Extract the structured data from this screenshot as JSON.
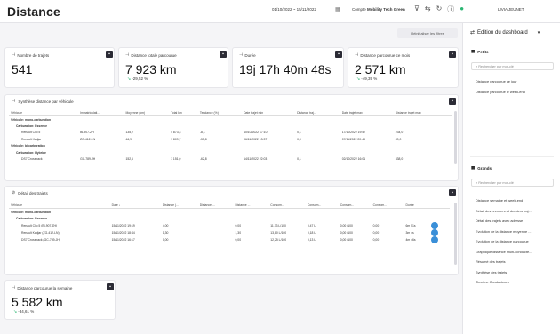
{
  "header": {
    "title": "Distance",
    "date_range": "01/10/2022 ~ 15/11/2022",
    "account_prefix": "Compte",
    "account_name": "Mobility Tech Green",
    "user": "LIVIA JEUNET",
    "icons": [
      "calendar-icon",
      "filter-icon",
      "reset-filter-icon",
      "refresh-icon",
      "help-icon",
      "user-icon"
    ]
  },
  "toolbar": {
    "reset_label": "Réinitialiser les filtres"
  },
  "kpis": [
    {
      "label": "Nombre de trajets",
      "value": "541",
      "delta": ""
    },
    {
      "label": "Distance totale parcourue",
      "value": "7 923 km",
      "delta": "-29,52 %"
    },
    {
      "label": "Durée",
      "value": "19j 17h 40m 48s",
      "delta": ""
    },
    {
      "label": "Distance parcourue ce mois",
      "value": "2 571 km",
      "delta": "-49,39 %"
    }
  ],
  "synthese": {
    "title": "Synthèse distance par véhicule",
    "columns": [
      "Véhicule",
      "Immatriculati...",
      "Moyenne (km)",
      "Total km",
      "Tendance (%)",
      "Date trajet min",
      "Distance traj...",
      "Date trajet max",
      "Distance trajet max"
    ],
    "rows": [
      {
        "type": "g1",
        "cells": [
          "Véhicule: mono-carburation",
          "",
          "",
          "",
          "",
          "",
          "",
          "",
          ""
        ]
      },
      {
        "type": "g2",
        "cells": [
          "Carburation: Essence",
          "",
          "",
          "",
          "",
          "",
          "",
          "",
          ""
        ]
      },
      {
        "type": "r",
        "cells": [
          "Renault Clio 5",
          "BI-907-ZH",
          "135,2",
          "4 873,3",
          "-8,1",
          "10/10/2022 17:10",
          "0,1",
          "17/10/2022 19:57",
          "234,0"
        ]
      },
      {
        "type": "r",
        "cells": [
          "Renault Kadjar",
          "ZG-412-LN",
          "46,9",
          "1 809,7",
          "-55,8",
          "06/11/2022 13:37",
          "0,0",
          "07/11/2022 20:48",
          "89,0"
        ]
      },
      {
        "type": "g1",
        "cells": [
          "Véhicule: bi-carburation",
          "",
          "",
          "",
          "",
          "",
          "",
          "",
          ""
        ]
      },
      {
        "type": "g2",
        "cells": [
          "Carburation: Hybride",
          "",
          "",
          "",
          "",
          "",
          "",
          "",
          ""
        ]
      },
      {
        "type": "r",
        "cells": [
          "DS7 Crossback",
          "GC-789-JH",
          "152,6",
          "1 151,0",
          "-62,8",
          "14/11/2022 22:03",
          "0,1",
          "02/10/2022 16:01",
          "338,0"
        ]
      }
    ]
  },
  "detail": {
    "title": "Détail des trajets",
    "columns": [
      "Véhicule",
      "Date ↓",
      "Distance (...",
      "Distance ...",
      "Distance ...",
      "Consom...",
      "Consom...",
      "Consom...",
      "Consom...",
      "Durée",
      ""
    ],
    "rows": [
      {
        "type": "g1",
        "cells": [
          "Véhicule: mono-carburation",
          "",
          "",
          "",
          "",
          "",
          "",
          "",
          "",
          "",
          ""
        ]
      },
      {
        "type": "g2",
        "cells": [
          "Carburation: Essence",
          "",
          "",
          "",
          "",
          "",
          "",
          "",
          "",
          "",
          ""
        ]
      },
      {
        "type": "r",
        "cells": [
          "Renault Clio 5 (BI-907-ZH)",
          "15/11/2022 19:19",
          "4,00",
          "",
          "0,00",
          "11,73 L/100",
          "0,47 L",
          "0,00 /100",
          "0,00",
          "6m 51s",
          ""
        ]
      },
      {
        "type": "r",
        "cells": [
          "Renault Kadjar (ZG-412-LN)",
          "15/11/2022 18:44",
          "1,30",
          "",
          "1,30",
          "13,80 L/100",
          "0,18 L",
          "0,00 /100",
          "0,00",
          "3m 4s",
          ""
        ]
      },
      {
        "type": "r",
        "cells": [
          "DS7 Crossback (GC-789-JH)",
          "15/11/2022 16:17",
          "0,00",
          "",
          "0,00",
          "12,25 L/100",
          "0,13 L",
          "0,00 /100",
          "0,00",
          "4m 46s",
          ""
        ]
      }
    ]
  },
  "weekly": {
    "label": "Distance parcourue la semaine",
    "value": "5 582 km",
    "delta": "-34,61 %"
  },
  "sidebar": {
    "title": "Edition du dashboard",
    "petits_title": "Petits",
    "search_placeholder": "Rechercher par mot-clé",
    "petits": [
      "Distance parcourue ce jour",
      "Distance parcourue le week-end"
    ],
    "grands_title": "Grands",
    "grands": [
      "Distance semaine et week-end",
      "Détail des premiers et derniers traj...",
      "Détail des trajets avec adresse",
      "Evolution de la distance moyenne ...",
      "Evolution de la distance parcourue",
      "Graphique distance multi-conducte...",
      "Résumé des trajets",
      "Synthèse des trajets",
      "Timeline Conducteurs"
    ]
  }
}
